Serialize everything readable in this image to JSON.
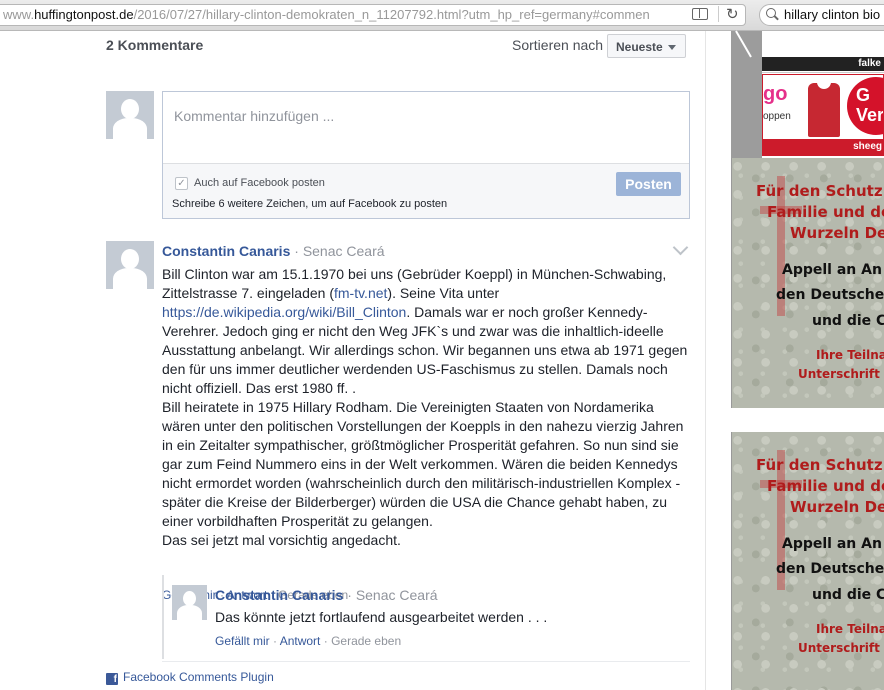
{
  "browser": {
    "url_prefix": "www.",
    "url_host": "huffingtonpost.de",
    "url_path": "/2016/07/27/hillary-clinton-demokraten_n_11207792.html?utm_hp_ref=germany#commen",
    "search_query": "hillary clinton bio"
  },
  "comments": {
    "count_label": "2 Kommentare",
    "sort_label": "Sortieren nach",
    "sort_value": "Neueste",
    "compose_placeholder": "Kommentar hinzufügen ...",
    "post_to_facebook_label": "Auch auf Facebook posten",
    "chars_note": "Schreibe 6 weitere Zeichen, um auf Facebook zu posten",
    "post_button": "Posten",
    "items": [
      {
        "author": "Constantin Canaris",
        "separator": " · ",
        "location": "Senac Ceará",
        "text_1a": "Bill Clinton war am 15.1.1970 bei uns (Gebrüder Koeppl) in München-Schwabing, Zittelstrasse 7. eingeladen (",
        "link_1": "fm-tv.net",
        "text_1b": "). Seine Vita unter ",
        "link_2": "https://de.wikipedia.org/wiki/Bill_Clinton",
        "text_1c": ". Damals war er noch großer Kennedy-Verehrer. Jedoch ging er nicht den Weg JFK`s und zwar was die inhaltlich-ideelle Ausstattung anbelangt. Wir allerdings schon. Wir begannen uns etwa ab 1971 gegen den für uns immer deutlicher werdenden US-Faschismus zu stellen. Damals noch nicht offiziell. Das erst 1980 ff. .",
        "text_2": "Bill heiratete in 1975 Hillary Rodham. Die Vereinigten Staaten von Nordamerika wären unter den politischen Vorstellungen der Koeppls in den nahezu vierzig Jahren in ein Zeitalter sympathischer, größtmöglicher Prosperität gefahren. So nun sind sie gar zum Feind Nummero eins in der Welt verkommen. Wären die beiden Kennedys nicht ermordet worden (wahrscheinlich durch den militärisch-industriellen Komplex - später die Kreise der Bilderberger) würden die USA die Chance gehabt haben, zu einer vorbildhaften Prosperität zu gelangen.",
        "text_3": "Das sei jetzt mal vorsichtig angedacht.",
        "like": "Gefällt mir",
        "reply": "Antwort",
        "time": "Gerade eben"
      },
      {
        "author": "Constantin Canaris",
        "separator": " · ",
        "location": "Senac Ceará",
        "text": "Das könnte jetzt fortlaufend ausgearbeitet werden . . .",
        "like": "Gefällt mir",
        "reply": "Antwort",
        "time": "Gerade eben"
      }
    ],
    "action_sep": " · ",
    "plugin_label": "Facebook Comments Plugin",
    "plugin_icon_letter": "f"
  },
  "ads": {
    "ad1_label": "falke",
    "ad2_brand": "go",
    "ad2_sub": "oppen",
    "ad2_circle_line1": "G",
    "ad2_circle_line2": "Ver",
    "ad2_label": "sheeg",
    "banner": {
      "line1": "Für den Schutz",
      "line2": "Familie und de",
      "line3": "Wurzeln De",
      "line4": "Appell an An",
      "line5": "den Deutsche",
      "line6": "und die C",
      "line7": "Ihre Teilna",
      "line8": "Unterschrift"
    }
  }
}
